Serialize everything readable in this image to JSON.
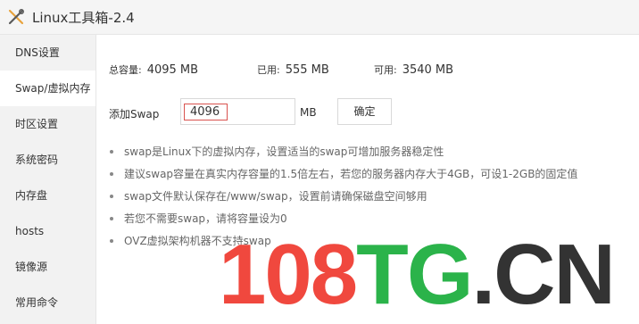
{
  "window": {
    "title": "Linux工具箱-2.4"
  },
  "sidebar": {
    "items": [
      {
        "label": "DNS设置",
        "active": false
      },
      {
        "label": "Swap/虚拟内存",
        "active": true
      },
      {
        "label": "时区设置",
        "active": false
      },
      {
        "label": "系统密码",
        "active": false
      },
      {
        "label": "内存盘",
        "active": false
      },
      {
        "label": "hosts",
        "active": false
      },
      {
        "label": "镜像源",
        "active": false
      },
      {
        "label": "常用命令",
        "active": false
      }
    ]
  },
  "memory": {
    "total_label": "总容量:",
    "total_value": "4095 MB",
    "used_label": "已用:",
    "used_value": "555 MB",
    "free_label": "可用:",
    "free_value": "3540 MB"
  },
  "swap_form": {
    "label": "添加Swap",
    "value": "4096",
    "unit": "MB",
    "confirm_label": "确定"
  },
  "tips": [
    "swap是Linux下的虚拟内存，设置适当的swap可增加服务器稳定性",
    "建议swap容量在真实内存容量的1.5倍左右，若您的服务器内存大于4GB，可设1-2GB的固定值",
    "swap文件默认保存在/www/swap，设置前请确保磁盘空间够用",
    "若您不需要swap，请将容量设为0",
    "OVZ虚拟架构机器不支持swap"
  ],
  "watermark": {
    "part1": "108",
    "part2": "TG",
    "part3": ".CN",
    "colors": {
      "part1": "#f0483e",
      "part2": "#2bb34a",
      "part3": "#333333"
    }
  }
}
